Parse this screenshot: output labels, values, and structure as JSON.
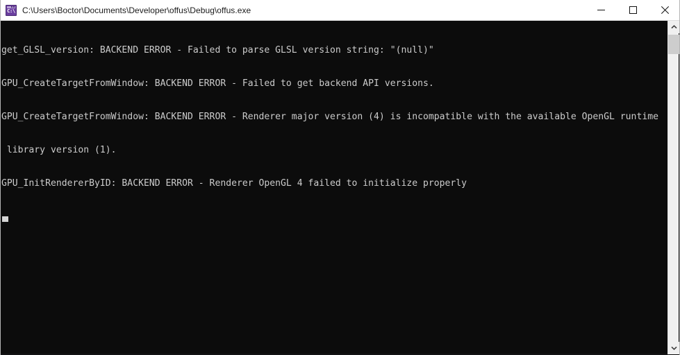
{
  "window": {
    "title": "C:\\Users\\Boctor\\Documents\\Developer\\offus\\Debug\\offus.exe",
    "icon_name": "command-prompt-icon",
    "icon_label": "C:\\",
    "background_color": "#0c0c0c",
    "titlebar_color": "#ffffff",
    "controls": {
      "minimize_label": "Minimize",
      "maximize_label": "Maximize",
      "close_label": "Close"
    }
  },
  "console": {
    "text_color": "#cccccc",
    "background_color": "#0c0c0c",
    "lines": [
      "get_GLSL_version: BACKEND ERROR - Failed to parse GLSL version string: \"(null)\"",
      "GPU_CreateTargetFromWindow: BACKEND ERROR - Failed to get backend API versions.",
      "GPU_CreateTargetFromWindow: BACKEND ERROR - Renderer major version (4) is incompatible with the available OpenGL runtime",
      " library version (1).",
      "GPU_InitRendererByID: BACKEND ERROR - Renderer OpenGL 4 failed to initialize properly"
    ],
    "cursor_visible": true
  },
  "scrollbar": {
    "up_arrow_name": "scroll-up-arrow",
    "down_arrow_name": "scroll-down-arrow",
    "thumb_name": "scroll-thumb",
    "track_color": "#f0f0f0",
    "thumb_color": "#cdcdcd"
  }
}
